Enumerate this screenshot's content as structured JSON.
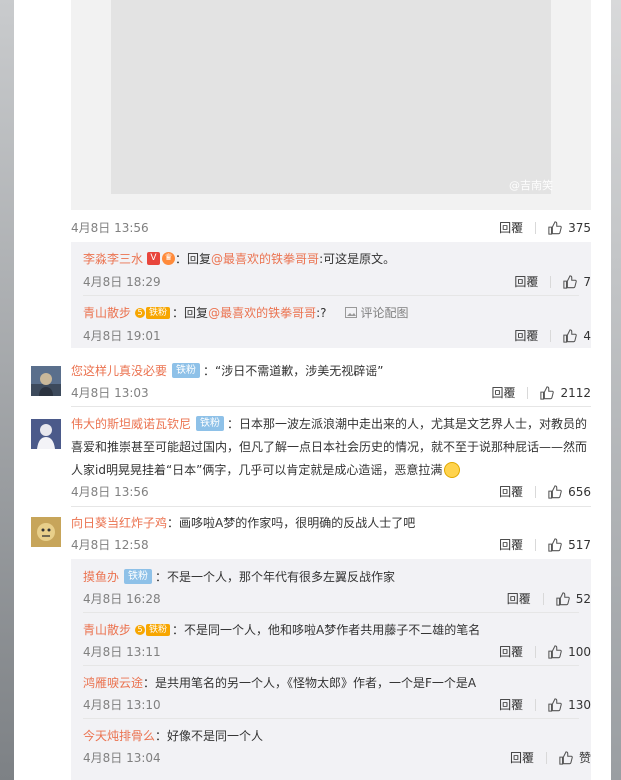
{
  "watermark": "@吉南笑",
  "post_meta": {
    "time": "4月8日 13:56",
    "reply": "回覆",
    "likes": "375"
  },
  "comments": [
    {
      "user": "您这样儿真没必要",
      "badge": "铁粉",
      "sep": "：",
      "text": "“涉日不需道歉，涉美无视辟谣”",
      "time": "4月8日 13:03",
      "reply": "回覆",
      "likes": "2112"
    },
    {
      "user": "伟大的斯坦威诺瓦钦尼",
      "badge": "铁粉",
      "sep": "：",
      "line1": "日本那一波左派浪潮中走出来的人，尤其是文艺界人士，对教员的",
      "line2": "喜爱和推崇甚至可能超过国内，但凡了解一点日本社会历史的情况，就不至于说那种屁话——然而",
      "line3": "人家id明晃晃挂着“日本”俩字，几乎可以肯定就是成心造谣，恶意拉满",
      "time": "4月8日 13:56",
      "reply": "回覆",
      "likes": "656"
    },
    {
      "user": "向日葵当红炸子鸡",
      "sep": "：",
      "text": "画哆啦A梦的作家吗，很明确的反战人士了吧",
      "time": "4月8日 12:58",
      "reply": "回覆",
      "likes": "517"
    }
  ],
  "replies_top": [
    {
      "user": "李淼李三水",
      "sep": "：",
      "prefix": "回复",
      "at": "@最喜欢的铁拳哥哥",
      "text": ":可这是原文。",
      "time": "4月8日 18:29",
      "reply": "回覆",
      "likes": "7"
    },
    {
      "user": "青山散步",
      "fan_level": "5",
      "fan_label": "铁粉",
      "sep": "：",
      "prefix": "回复",
      "at": "@最喜欢的铁拳哥哥",
      "text": ":?",
      "pic_link": "评论配图",
      "time": "4月8日 19:01",
      "reply": "回覆",
      "likes": "4"
    }
  ],
  "replies_bottom": [
    {
      "user": "摸鱼办",
      "badge": "铁粉",
      "sep": "：",
      "text": "不是一个人，那个年代有很多左翼反战作家",
      "time": "4月8日 16:28",
      "reply": "回覆",
      "likes": "52"
    },
    {
      "user": "青山散步",
      "fan_level": "5",
      "fan_label": "铁粉",
      "sep": "：",
      "text": "不是同一个人，他和哆啦A梦作者共用藤子不二雄的笔名",
      "time": "4月8日 13:11",
      "reply": "回覆",
      "likes": "100"
    },
    {
      "user": "鸿雁唳云途",
      "sep": "：",
      "text": "是共用笔名的另一个人，《怪物太郎》作者，一个是F一个是A",
      "time": "4月8日 13:10",
      "reply": "回覆",
      "likes": "130"
    },
    {
      "user": "今天炖排骨么",
      "sep": "：",
      "text": "好像不是同一个人",
      "time": "4月8日 13:04",
      "reply": "回覆",
      "likes": "赞"
    }
  ],
  "colors": {
    "username": "#eb7350",
    "badge": "#8ec1e8",
    "reply_bg": "#f2f2f5",
    "muted": "#808080"
  }
}
